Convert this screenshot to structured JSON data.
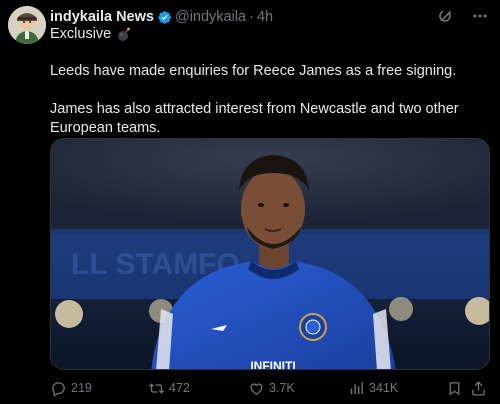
{
  "tweet": {
    "display_name": "indykaila News",
    "handle": "@indykaila",
    "separator": "·",
    "time": "4h",
    "subhead": "Exclusive",
    "paragraphs": [
      "Leeds have made enquiries for Reece James as a free signing.",
      "James has also attracted interest from Newcastle and two other European teams."
    ],
    "media_shirt_text": "INFINITI"
  },
  "actions": {
    "replies": "219",
    "reposts": "472",
    "likes": "3.7K",
    "views": "341K"
  },
  "colors": {
    "background": "#000000",
    "text": "#e7e9ea",
    "muted": "#71767b",
    "verified": "#1d9bf0",
    "kit_blue": "#1f4fc4"
  },
  "icons": [
    "avatar",
    "verified-badge-icon",
    "grok-icon",
    "more-icon",
    "bomb-emoji-icon",
    "reply-icon",
    "repost-icon",
    "like-icon",
    "views-icon",
    "bookmark-icon",
    "share-icon"
  ]
}
